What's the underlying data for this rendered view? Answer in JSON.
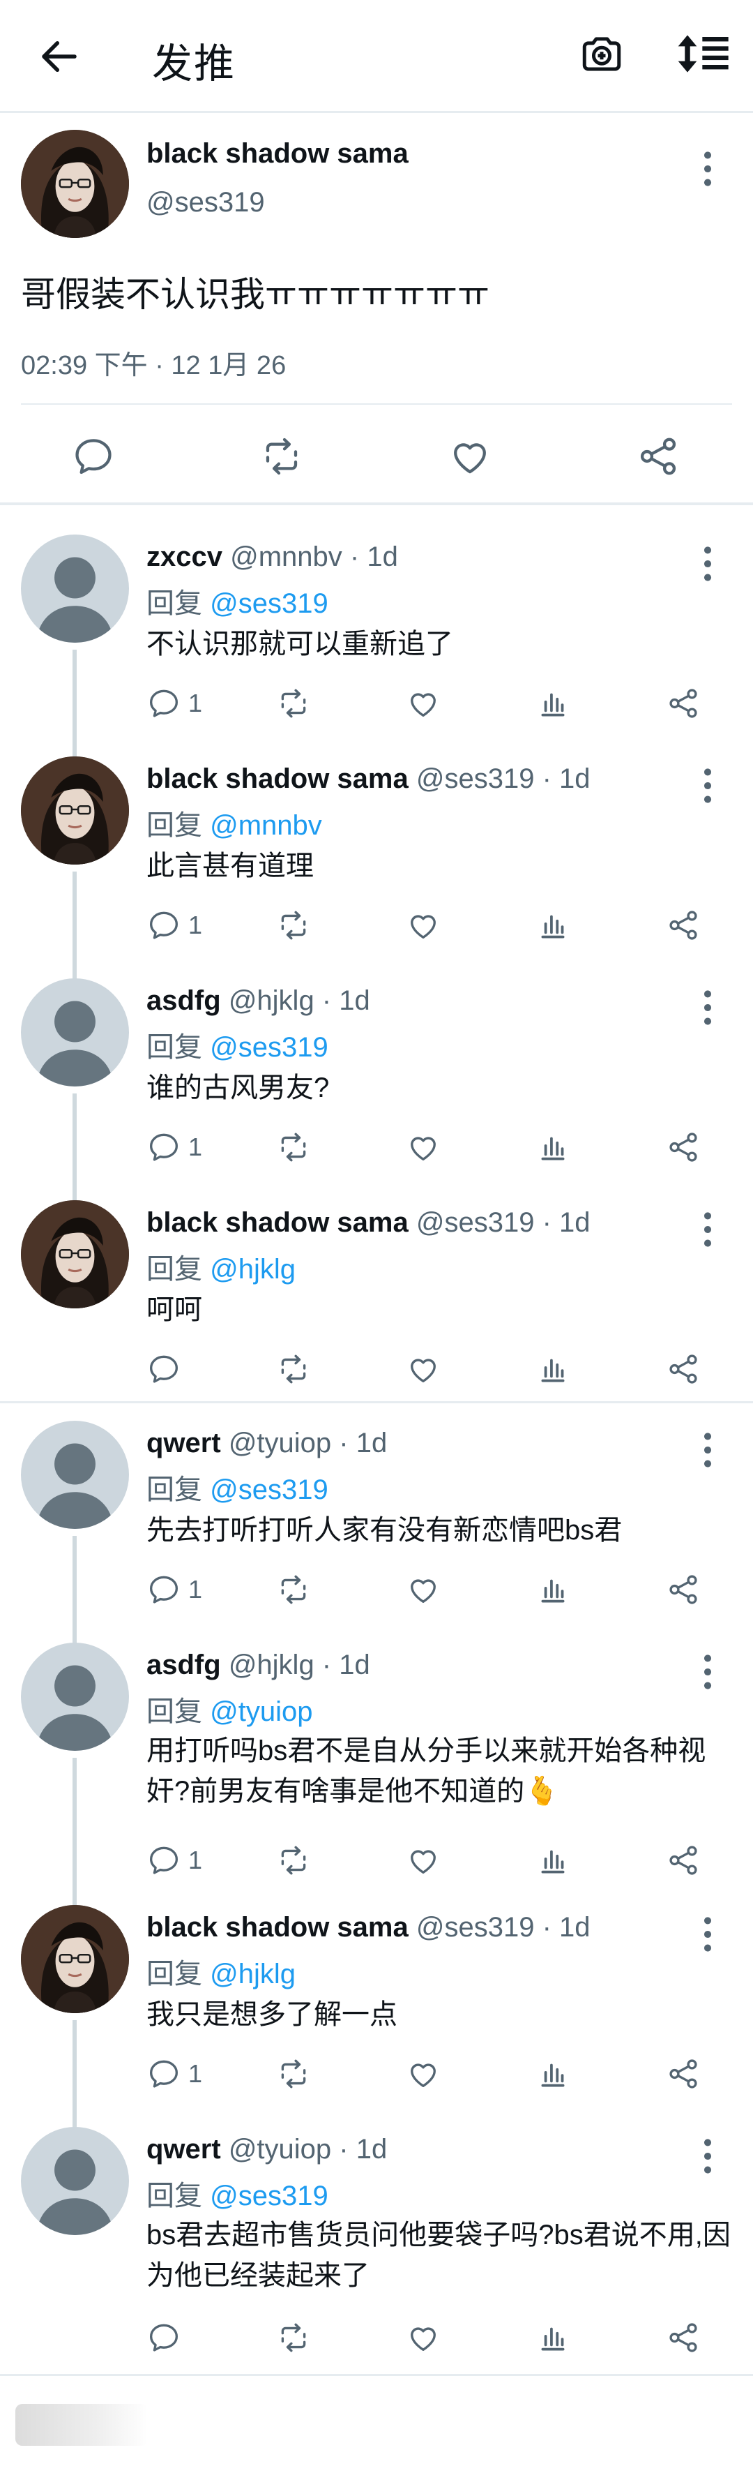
{
  "header": {
    "title": "发推"
  },
  "main_tweet": {
    "name": "black shadow sama",
    "handle": "@ses319",
    "text": "哥假装不认识我ㅠㅠㅠㅠㅠㅠㅠ",
    "timestamp": "02:39 下午 · 12 1月 26"
  },
  "reply_label": "回复",
  "replies": [
    {
      "name": "zxccv",
      "handle": "@mnnbv",
      "time": " · 1d",
      "reply_to": "@ses319",
      "text": "不认识那就可以重新追了",
      "reply_count": "1"
    },
    {
      "name": "black shadow sama",
      "handle": "@ses319",
      "time": " · 1d",
      "reply_to": "@mnnbv",
      "text": "此言甚有道理",
      "reply_count": "1"
    },
    {
      "name": "asdfg",
      "handle": "@hjklg",
      "time": " · 1d",
      "reply_to": "@ses319",
      "text": "谁的古风男友?",
      "reply_count": "1"
    },
    {
      "name": "black shadow sama",
      "handle": "@ses319",
      "time": " · 1d",
      "reply_to": "@hjklg",
      "text": "呵呵",
      "reply_count": ""
    },
    {
      "name": "qwert",
      "handle": "@tyuiop",
      "time": " · 1d",
      "reply_to": "@ses319",
      "text": "先去打听打听人家有没有新恋情吧bs君",
      "reply_count": "1"
    },
    {
      "name": "asdfg",
      "handle": "@hjklg",
      "time": " · 1d",
      "reply_to": "@tyuiop",
      "text": "用打听吗bs君不是自从分手以来就开始各种视奸?前男友有啥事是他不知道的",
      "text_emoji": "🫰",
      "reply_count": "1"
    },
    {
      "name": "black shadow sama",
      "handle": "@ses319",
      "time": " · 1d",
      "reply_to": "@hjklg",
      "text": "我只是想多了解一点",
      "reply_count": "1"
    },
    {
      "name": "qwert",
      "handle": "@tyuiop",
      "time": " · 1d",
      "reply_to": "@ses319",
      "text": "bs君去超市售货员问他要袋子吗?bs君说不用,因为他已经装起来了",
      "reply_count": ""
    }
  ],
  "colors": {
    "accent": "#1d9bf0",
    "text": "#0f1419",
    "secondary": "#536471",
    "divider": "#e6ecf0",
    "thread_line": "#cfd9de"
  }
}
